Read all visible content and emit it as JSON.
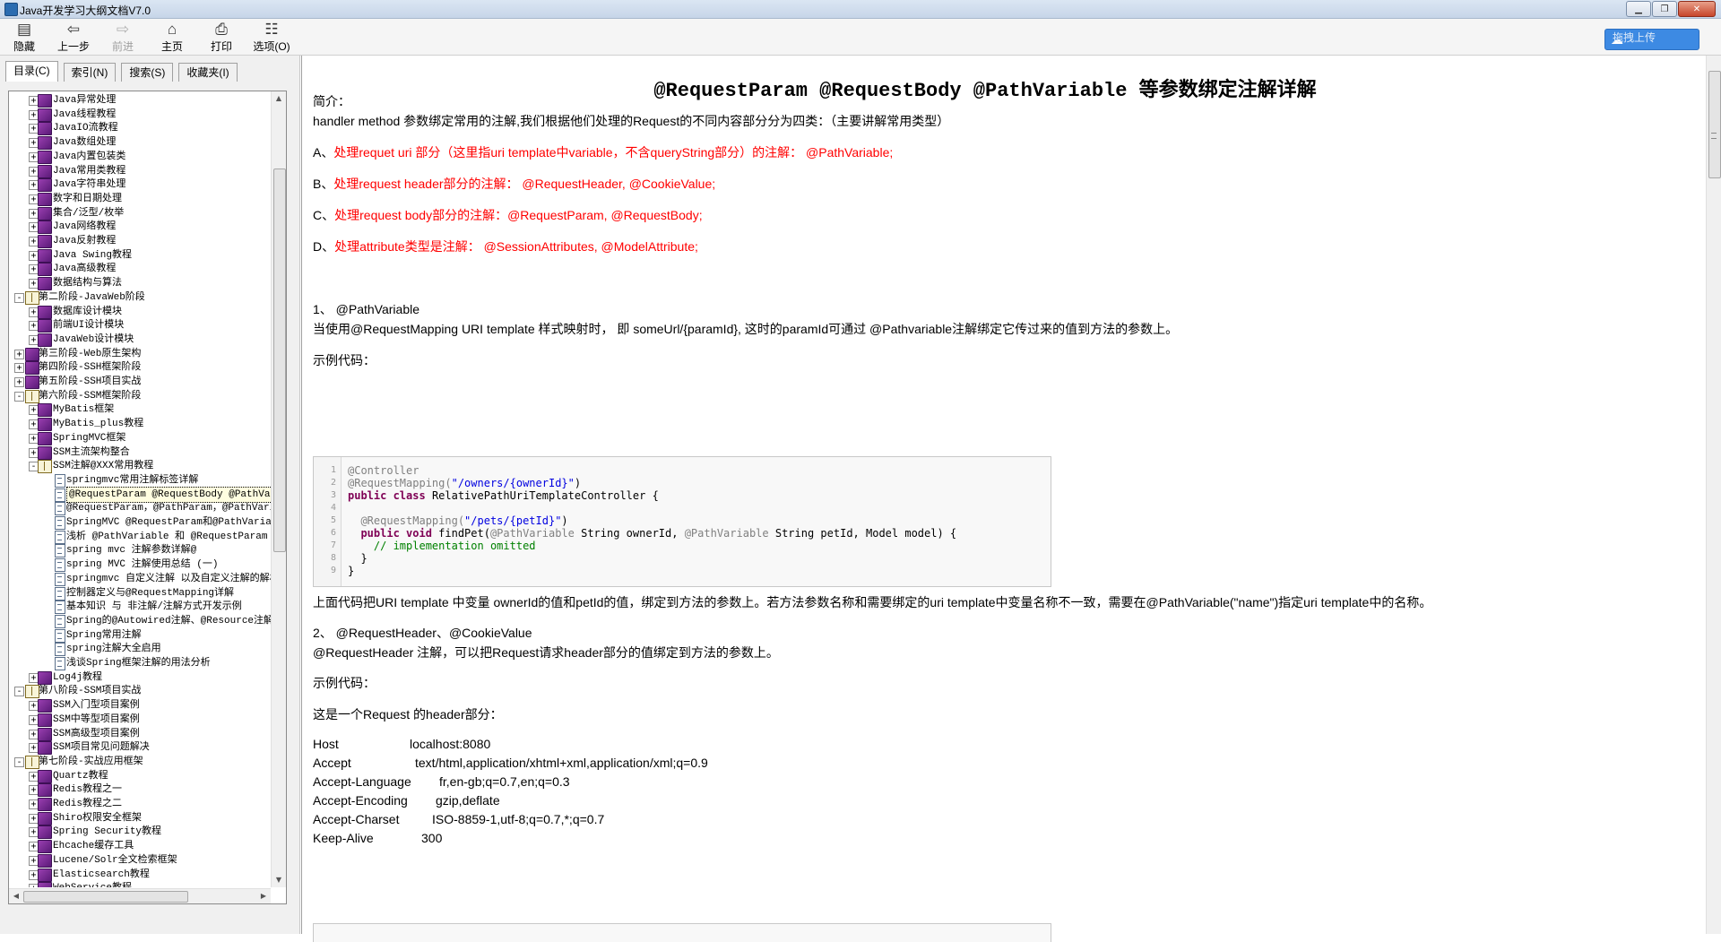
{
  "window": {
    "title": "Java开发学习大纲文档V7.0"
  },
  "toolbar": {
    "hide": "隐藏",
    "back": "上一步",
    "forward": "前进",
    "home": "主页",
    "print": "打印",
    "options": "选项(O)",
    "upload": "拖拽上传"
  },
  "tabs": [
    "目录(C)",
    "索引(N)",
    "搜索(S)",
    "收藏夹(I)"
  ],
  "tree": [
    {
      "level": 2,
      "exp": "+",
      "icon": "book",
      "label": "Java异常处理"
    },
    {
      "level": 2,
      "exp": "+",
      "icon": "book",
      "label": "Java线程教程"
    },
    {
      "level": 2,
      "exp": "+",
      "icon": "book",
      "label": "JavaIO流教程"
    },
    {
      "level": 2,
      "exp": "+",
      "icon": "book",
      "label": "Java数组处理"
    },
    {
      "level": 2,
      "exp": "+",
      "icon": "book",
      "label": "Java内置包装类"
    },
    {
      "level": 2,
      "exp": "+",
      "icon": "book",
      "label": "Java常用类教程"
    },
    {
      "level": 2,
      "exp": "+",
      "icon": "book",
      "label": "Java字符串处理"
    },
    {
      "level": 2,
      "exp": "+",
      "icon": "book",
      "label": "数字和日期处理"
    },
    {
      "level": 2,
      "exp": "+",
      "icon": "book",
      "label": "集合/泛型/枚举"
    },
    {
      "level": 2,
      "exp": "+",
      "icon": "book",
      "label": "Java网络教程"
    },
    {
      "level": 2,
      "exp": "+",
      "icon": "book",
      "label": "Java反射教程"
    },
    {
      "level": 2,
      "exp": "+",
      "icon": "book",
      "label": "Java Swing教程"
    },
    {
      "level": 2,
      "exp": "+",
      "icon": "book",
      "label": "Java高级教程"
    },
    {
      "level": 2,
      "exp": "+",
      "icon": "book",
      "label": "数据结构与算法"
    },
    {
      "level": 1,
      "exp": "-",
      "icon": "open",
      "label": "第二阶段-JavaWeb阶段"
    },
    {
      "level": 2,
      "exp": "+",
      "icon": "book",
      "label": "数据库设计模块"
    },
    {
      "level": 2,
      "exp": "+",
      "icon": "book",
      "label": "前端UI设计模块"
    },
    {
      "level": 2,
      "exp": "+",
      "icon": "book",
      "label": "JavaWeb设计模块"
    },
    {
      "level": 1,
      "exp": "+",
      "icon": "book",
      "label": "第三阶段-Web原生架构"
    },
    {
      "level": 1,
      "exp": "+",
      "icon": "book",
      "label": "第四阶段-SSH框架阶段"
    },
    {
      "level": 1,
      "exp": "+",
      "icon": "book",
      "label": "第五阶段-SSH项目实战"
    },
    {
      "level": 1,
      "exp": "-",
      "icon": "open",
      "label": "第六阶段-SSM框架阶段"
    },
    {
      "level": 2,
      "exp": "+",
      "icon": "book",
      "label": "MyBatis框架"
    },
    {
      "level": 2,
      "exp": "+",
      "icon": "book",
      "label": "MyBatis_plus教程"
    },
    {
      "level": 2,
      "exp": "+",
      "icon": "book",
      "label": "SpringMVC框架"
    },
    {
      "level": 2,
      "exp": "+",
      "icon": "book",
      "label": "SSM主流架构整合"
    },
    {
      "level": 2,
      "exp": "-",
      "icon": "open",
      "label": "SSM注解@XXX常用教程"
    },
    {
      "level": 3,
      "exp": "",
      "icon": "page",
      "label": "springmvc常用注解标签详解"
    },
    {
      "level": 3,
      "exp": "",
      "icon": "page",
      "label": "@RequestParam @RequestBody @PathVariable 等参数绑定注解详解",
      "selected": true
    },
    {
      "level": 3,
      "exp": "",
      "icon": "page",
      "label": "@RequestParam，@PathParam，@PathVariable等注解区别"
    },
    {
      "level": 3,
      "exp": "",
      "icon": "page",
      "label": "SpringMVC @RequestParam和@PathVariable的区别"
    },
    {
      "level": 3,
      "exp": "",
      "icon": "page",
      "label": "浅析 @PathVariable 和 @RequestParam"
    },
    {
      "level": 3,
      "exp": "",
      "icon": "page",
      "label": "spring mvc 注解参数详解@"
    },
    {
      "level": 3,
      "exp": "",
      "icon": "page",
      "label": "spring MVC 注解使用总结 (一)"
    },
    {
      "level": 3,
      "exp": "",
      "icon": "page",
      "label": "springmvc 自定义注解 以及自定义注解的解析"
    },
    {
      "level": 3,
      "exp": "",
      "icon": "page",
      "label": "控制器定义与@RequestMapping详解"
    },
    {
      "level": 3,
      "exp": "",
      "icon": "page",
      "label": "基本知识 与 非注解/注解方式开发示例"
    },
    {
      "level": 3,
      "exp": "",
      "icon": "page",
      "label": "Spring的@Autowired注解、@Resource注解"
    },
    {
      "level": 3,
      "exp": "",
      "icon": "page",
      "label": "Spring常用注解"
    },
    {
      "level": 3,
      "exp": "",
      "icon": "page",
      "label": "spring注解大全启用"
    },
    {
      "level": 3,
      "exp": "",
      "icon": "page",
      "label": "浅谈Spring框架注解的用法分析"
    },
    {
      "level": 2,
      "exp": "+",
      "icon": "book",
      "label": "Log4j教程"
    },
    {
      "level": 1,
      "exp": "-",
      "icon": "open",
      "label": "第八阶段-SSM项目实战"
    },
    {
      "level": 2,
      "exp": "+",
      "icon": "book",
      "label": "SSM入门型项目案例"
    },
    {
      "level": 2,
      "exp": "+",
      "icon": "book",
      "label": "SSM中等型项目案例"
    },
    {
      "level": 2,
      "exp": "+",
      "icon": "book",
      "label": "SSM高级型项目案例"
    },
    {
      "level": 2,
      "exp": "+",
      "icon": "book",
      "label": "SSM项目常见问题解决"
    },
    {
      "level": 1,
      "exp": "-",
      "icon": "open",
      "label": "第七阶段-实战应用框架"
    },
    {
      "level": 2,
      "exp": "+",
      "icon": "book",
      "label": "Quartz教程"
    },
    {
      "level": 2,
      "exp": "+",
      "icon": "book",
      "label": "Redis教程之一"
    },
    {
      "level": 2,
      "exp": "+",
      "icon": "book",
      "label": "Redis教程之二"
    },
    {
      "level": 2,
      "exp": "+",
      "icon": "book",
      "label": "Shiro权限安全框架"
    },
    {
      "level": 2,
      "exp": "+",
      "icon": "book",
      "label": "Spring Security教程"
    },
    {
      "level": 2,
      "exp": "+",
      "icon": "book",
      "label": "Ehcache缓存工具"
    },
    {
      "level": 2,
      "exp": "+",
      "icon": "book",
      "label": "Lucene/Solr全文检索框架"
    },
    {
      "level": 2,
      "exp": "+",
      "icon": "book",
      "label": "Elasticsearch教程"
    },
    {
      "level": 2,
      "exp": "+",
      "icon": "book",
      "label": "WebService教程"
    }
  ],
  "doc": {
    "title": "@RequestParam @RequestBody @PathVariable 等参数绑定注解详解",
    "intro_label": "简介：",
    "intro": "handler method 参数绑定常用的注解,我们根据他们处理的Request的不同内容部分分为四类：（主要讲解常用类型）",
    "a_prefix": "A、",
    "a_text": "处理requet uri 部分（这里指uri template中variable，不含queryString部分）的注解：   @PathVariable;",
    "b_prefix": "B、",
    "b_text": "处理request header部分的注解：   @RequestHeader, @CookieValue;",
    "c_prefix": "C、",
    "c_text": "处理request body部分的注解：@RequestParam,  @RequestBody;",
    "d_prefix": "D、",
    "d_text": "处理attribute类型是注解：  @SessionAttributes, @ModelAttribute;",
    "s1_heading": "1、  @PathVariable",
    "s1_text": "当使用@RequestMapping URI template 样式映射时， 即 someUrl/{paramId}, 这时的paramId可通过 @Pathvariable注解绑定它传过来的值到方法的参数上。",
    "example_label": "示例代码：",
    "s1_after": "上面代码把URI template 中变量 ownerId的值和petId的值，绑定到方法的参数上。若方法参数名称和需要绑定的uri template中变量名称不一致，需要在@PathVariable(\"name\")指定uri template中的名称。",
    "s2_heading": "2、  @RequestHeader、@CookieValue",
    "s2_text": "@RequestHeader 注解，可以把Request请求header部分的值绑定到方法的参数上。",
    "example_label2": "示例代码：",
    "header_intro": "这是一个Request 的header部分：",
    "headers": [
      {
        "k": "Host",
        "v": "localhost:8080"
      },
      {
        "k": "Accept",
        "v": "text/html,application/xhtml+xml,application/xml;q=0.9"
      },
      {
        "k": "Accept-Language",
        "v": "fr,en-gb;q=0.7,en;q=0.3"
      },
      {
        "k": "Accept-Encoding",
        "v": "gzip,deflate"
      },
      {
        "k": "Accept-Charset",
        "v": "ISO-8859-1,utf-8;q=0.7,*;q=0.7"
      },
      {
        "k": "Keep-Alive",
        "v": "300"
      }
    ],
    "code_line_numbers": [
      "1",
      "2",
      "3",
      "4",
      "5",
      "6",
      "7",
      "8",
      "9"
    ],
    "code": {
      "l1": "@Controller",
      "l2a": "@RequestMapping(",
      "l2b": "\"/owners/{ownerId}\"",
      "l2c": ")",
      "l3a": "public ",
      "l3b": "class ",
      "l3c": "RelativePathUriTemplateController {",
      "l5a": "  @RequestMapping(",
      "l5b": "\"/pets/{petId}\"",
      "l5c": ")",
      "l6a": "  public void ",
      "l6b": "findPet(",
      "l6c": "@PathVariable",
      "l6d": " String ownerId, ",
      "l6e": "@PathVariable",
      "l6f": " String petId, Model model) {",
      "l7": "    // implementation omitted",
      "l8": "  }",
      "l9": "}"
    }
  }
}
